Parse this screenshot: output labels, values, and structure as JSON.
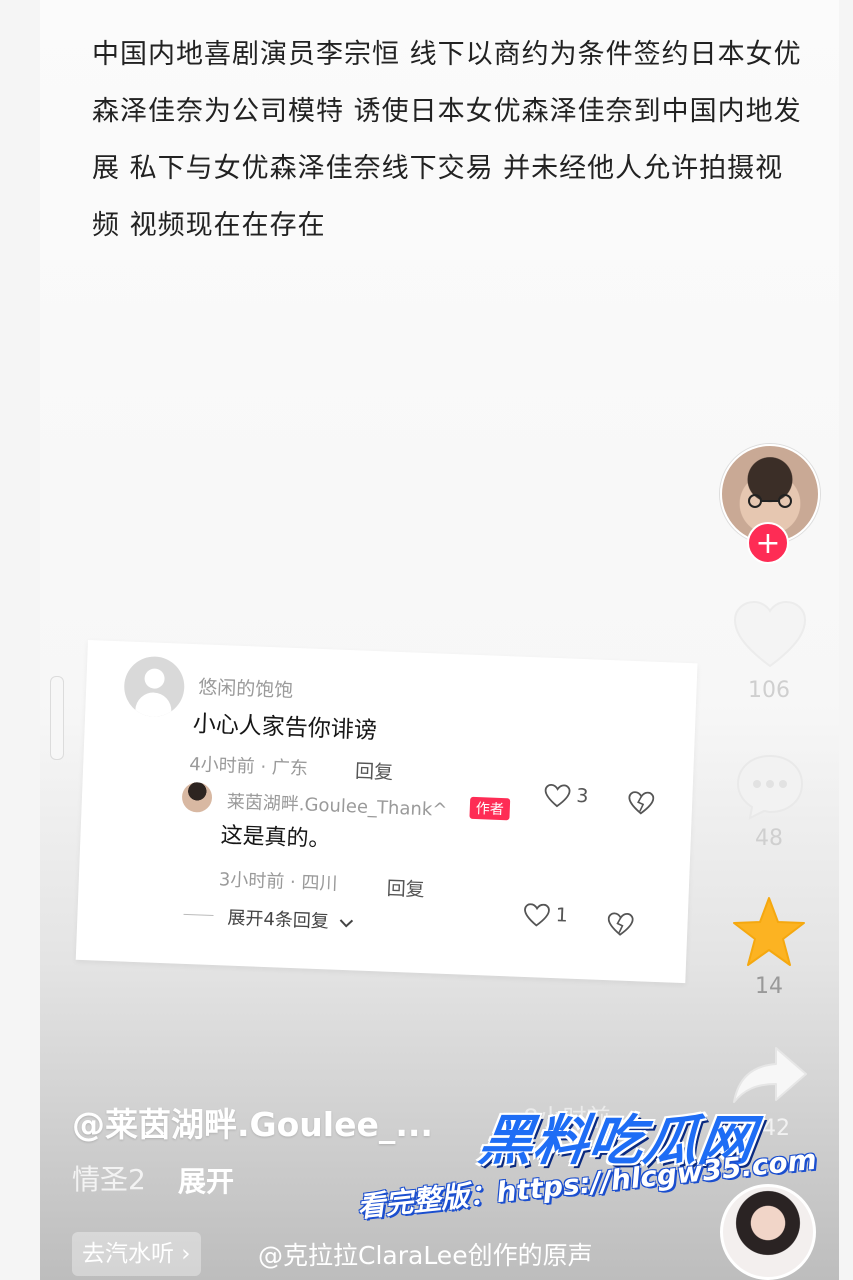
{
  "post": {
    "text": "中国内地喜剧演员李宗恒 线下以商约为条件签约日本女优森泽佳奈为公司模特 诱使日本女优森泽佳奈到中国内地发展 私下与女优森泽佳奈线下交易 并未经他人允许拍摄视频 视频现在在存在"
  },
  "rail": {
    "follow_symbol": "+",
    "likes": "106",
    "comments": "48",
    "favorites": "14",
    "shares": "142"
  },
  "comment_card": {
    "comment": {
      "username": "悠闲的饱饱",
      "text": "小心人家告你诽谤",
      "meta": "4小时前 · 广东",
      "reply_label": "回复",
      "like_count": "3"
    },
    "reply": {
      "username": "莱茵湖畔.Goulee_Thank^",
      "author_badge": "作者",
      "text": "这是真的。",
      "meta": "3小时前 · 四川",
      "reply_label": "回复",
      "like_count": "1"
    },
    "expand_label": "展开4条回复"
  },
  "video_info": {
    "author": "@莱茵湖畔.Goulee_...",
    "time": "· 8小时前",
    "description": "情圣2",
    "expand_label": "展开",
    "music_chip": "去汽水听 ›",
    "music_text": "@克拉拉ClaraLee创作的原声"
  },
  "watermark": {
    "title": "黑料吃瓜网",
    "url": "看完整版：https://hlcgw35.com"
  },
  "colors": {
    "accent": "#fe2c55",
    "favorite": "#fcb322",
    "watermark_blue": "#1e6df5"
  }
}
